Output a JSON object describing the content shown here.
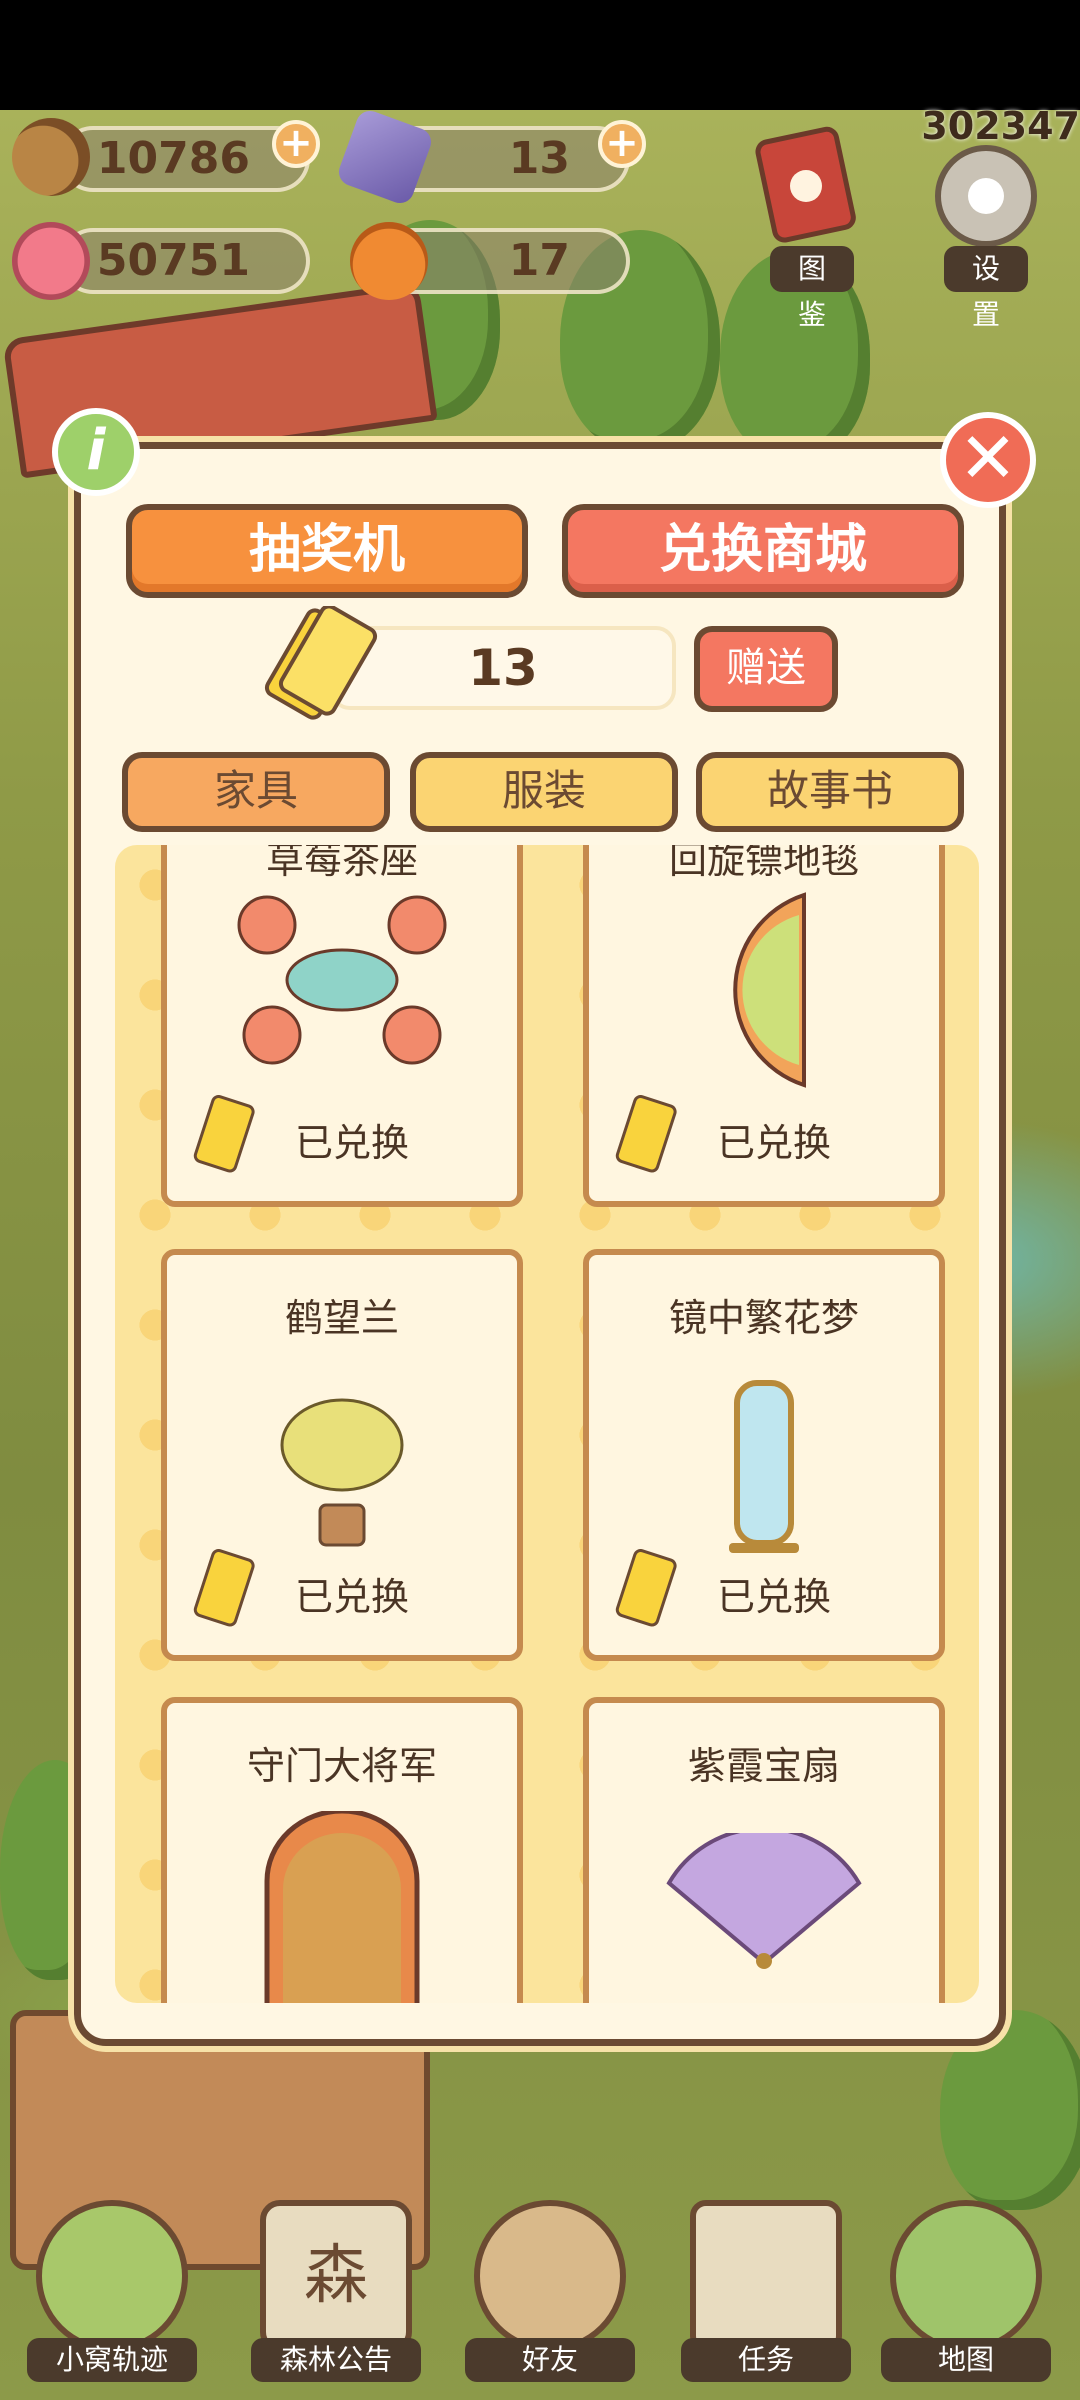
{
  "resources": {
    "acorns": "10786",
    "gems": "13",
    "hearts": "50751",
    "pumpkins": "17"
  },
  "top_right": {
    "counter": "302347",
    "atlas_label": "图鉴",
    "settings_label": "设置"
  },
  "modal": {
    "info_label": "i",
    "close_label": "✕",
    "tabs": {
      "lottery": "抽奖机",
      "shop": "兑换商城"
    },
    "ticket_count": "13",
    "gift_label": "赠送",
    "categories": {
      "furniture": "家具",
      "clothes": "服装",
      "storybook": "故事书"
    },
    "items": [
      {
        "title": "草莓茶座",
        "status": "已兑换"
      },
      {
        "title": "回旋镖地毯",
        "status": "已兑换"
      },
      {
        "title": "鹤望兰",
        "status": "已兑换"
      },
      {
        "title": "镜中繁花梦",
        "status": "已兑换"
      },
      {
        "title": "守门大将军"
      },
      {
        "title": "紫霞宝扇"
      }
    ]
  },
  "bottom_nav": {
    "nest_trail": "小窝轨迹",
    "forest_notice": "森林公告",
    "forest_notice_icon_text": "森",
    "friends": "好友",
    "tasks": "任务",
    "map": "地图"
  },
  "colors": {
    "accent_orange": "#f7913e",
    "accent_red": "#f47761",
    "panel_border": "#6b4a32",
    "panel_bg": "#fff7e3"
  }
}
